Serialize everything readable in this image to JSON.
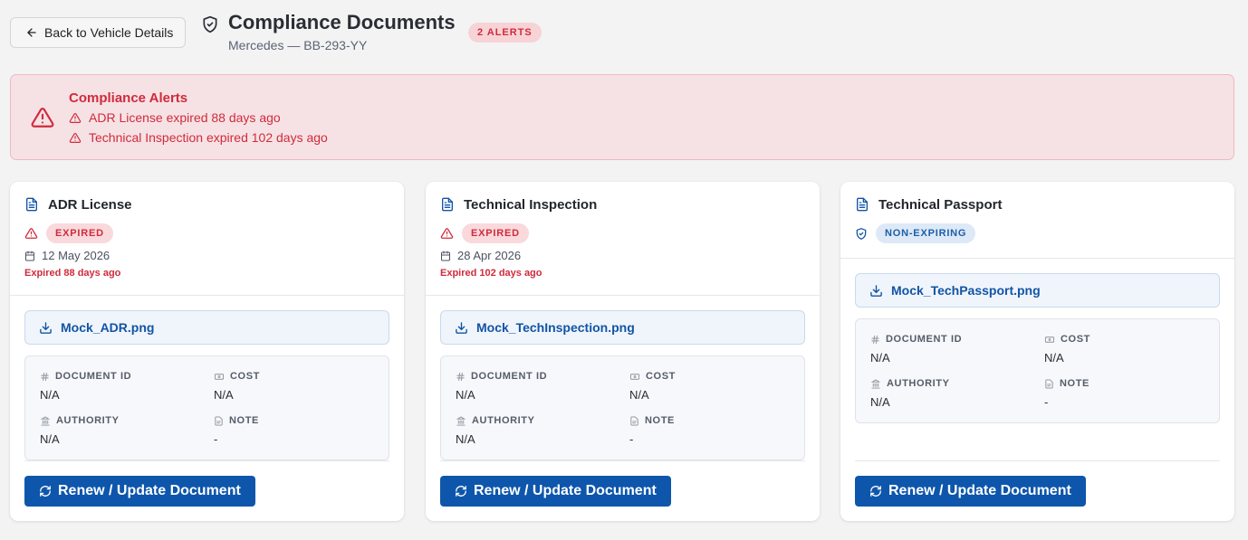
{
  "header": {
    "back_label": "Back to Vehicle Details",
    "title": "Compliance Documents",
    "subtitle": "Mercedes — BB-293-YY",
    "alerts_badge": "2 ALERTS"
  },
  "alerts": {
    "title": "Compliance Alerts",
    "items": [
      "ADR License expired 88 days ago",
      "Technical Inspection expired 102 days ago"
    ]
  },
  "field_labels": {
    "document_id": "DOCUMENT ID",
    "cost": "COST",
    "authority": "AUTHORITY",
    "note": "NOTE"
  },
  "documents": [
    {
      "title": "ADR License",
      "status": "EXPIRED",
      "date": "12 May 2026",
      "expired_note": "Expired 88 days ago",
      "file": "Mock_ADR.png",
      "document_id": "N/A",
      "cost": "N/A",
      "authority": "N/A",
      "note": "-",
      "action": "Renew / Update Document"
    },
    {
      "title": "Technical Inspection",
      "status": "EXPIRED",
      "date": "28 Apr 2026",
      "expired_note": "Expired 102 days ago",
      "file": "Mock_TechInspection.png",
      "document_id": "N/A",
      "cost": "N/A",
      "authority": "N/A",
      "note": "-",
      "action": "Renew / Update Document"
    },
    {
      "title": "Technical Passport",
      "status": "NON-EXPIRING",
      "file": "Mock_TechPassport.png",
      "document_id": "N/A",
      "cost": "N/A",
      "authority": "N/A",
      "note": "-",
      "action": "Renew / Update Document"
    }
  ],
  "colors": {
    "alert_red": "#d02b3d",
    "primary_blue": "#0d56ab",
    "banner_bg": "#f6e2e4"
  },
  "icons": {
    "back": "arrow-left-icon",
    "title": "shield-check-icon",
    "alert": "alert-triangle-icon",
    "document": "file-text-icon",
    "calendar": "calendar-icon",
    "download": "download-icon",
    "document_id": "hash-icon",
    "cost": "banknote-icon",
    "authority": "landmark-icon",
    "note": "note-icon",
    "renew": "refresh-icon"
  }
}
